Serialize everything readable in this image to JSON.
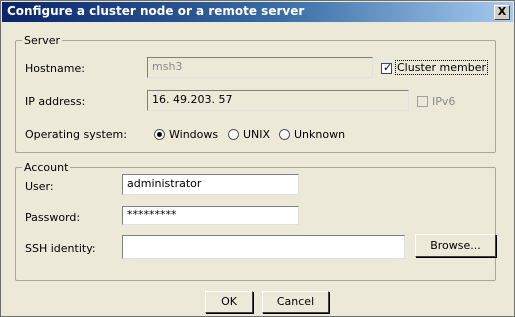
{
  "dialog": {
    "title": "Configure a cluster node or a remote server",
    "close_label": "X"
  },
  "server": {
    "legend": "Server",
    "hostname_label": "Hostname:",
    "hostname_value": "msh3",
    "cluster_member_label": "Cluster member",
    "cluster_member_checked": true,
    "ip_label": "IP address:",
    "ip_value": "16. 49.203. 57",
    "ipv6_label": "IPv6",
    "ipv6_checked": false,
    "os_label": "Operating system:",
    "os_options": [
      "Windows",
      "UNIX",
      "Unknown"
    ],
    "os_selected": "Windows"
  },
  "account": {
    "legend": "Account",
    "user_label": "User:",
    "user_value": "administrator",
    "password_label": "Password:",
    "password_value": "*********",
    "ssh_label": "SSH identity:",
    "ssh_value": "",
    "browse_label": "Browse..."
  },
  "buttons": {
    "ok": "OK",
    "cancel": "Cancel"
  }
}
